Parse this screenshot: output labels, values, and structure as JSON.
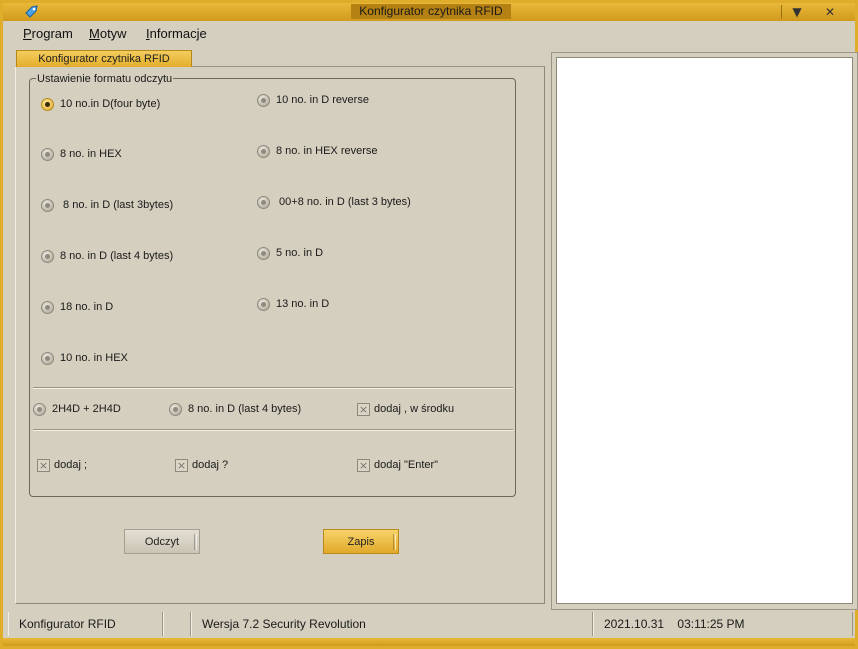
{
  "window": {
    "title": "Konfigurator czytnika RFID",
    "controls": {
      "menu": "▼",
      "close": "✕"
    }
  },
  "menu": [
    {
      "first": "P",
      "rest": "rogram"
    },
    {
      "first": "M",
      "rest": "otyw"
    },
    {
      "first": "I",
      "rest": "nformacje"
    }
  ],
  "tab": {
    "label": "Konfigurator czytnika RFID"
  },
  "group": {
    "title": "Ustawienie formatu odczytu"
  },
  "radios": {
    "r1": "10 no.in D(four byte)",
    "r2": "10 no. in D reverse",
    "r3": "8 no. in HEX",
    "r4": "8 no. in HEX reverse",
    "r5": " 8 no. in D (last 3bytes)",
    "r6": " 00+8 no. in D (last 3 bytes)",
    "r7": "8 no. in D (last 4 bytes)",
    "r8": "5 no. in D",
    "r9": "18 no. in D",
    "r10": "13 no. in D",
    "r11": "10 no. in HEX",
    "r12": "2H4D + 2H4D",
    "r13": "8 no. in D (last 4 bytes)"
  },
  "selected_radio": "r1",
  "checkboxes": {
    "c1": "dodaj , w środku",
    "c2": "dodaj ;",
    "c3": "dodaj ?",
    "c4": "dodaj \"Enter\""
  },
  "buttons": {
    "read": "Odczyt",
    "save": "Zapis"
  },
  "status": {
    "app": "Konfigurator RFID",
    "empty": "",
    "version": "Wersja 7.2 Security Revolution",
    "datetime": "2021.10.31    03:11:25 PM"
  },
  "colors": {
    "accent": "#e2ad2c",
    "background": "#d4cfbf",
    "output": "#ffffff"
  }
}
